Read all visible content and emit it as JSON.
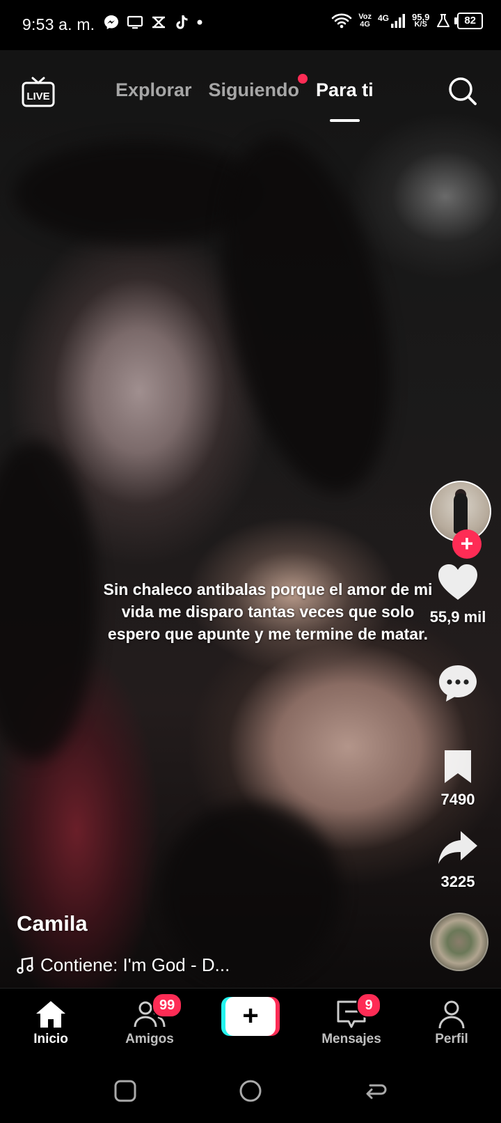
{
  "status_bar": {
    "time": "9:53 a. m.",
    "voz_top": "Voz",
    "voz_bottom": "4G",
    "network": "4G",
    "speed_top": "95,9",
    "speed_bottom": "K/S",
    "battery": "82"
  },
  "top_nav": {
    "live_label": "LIVE",
    "tabs": [
      "Explorar",
      "Siguiendo",
      "Para ti"
    ],
    "active_tab": "Para ti"
  },
  "video": {
    "caption": "Sin chaleco antibalas porque el amor de mi vida me disparo tantas veces que solo espero que apunte y me termine de matar.",
    "author": "Camila",
    "music": "Contiene: I'm God - D..."
  },
  "right_rail": {
    "likes": "55,9 mil",
    "bookmarks": "7490",
    "shares": "3225"
  },
  "bottom_nav": {
    "items": [
      {
        "label": "Inicio"
      },
      {
        "label": "Amigos",
        "badge": "99"
      },
      {
        "label": "Mensajes",
        "badge": "9"
      },
      {
        "label": "Perfil"
      }
    ]
  },
  "colors": {
    "accent": "#fe2c55",
    "cyan": "#25f4ee"
  }
}
